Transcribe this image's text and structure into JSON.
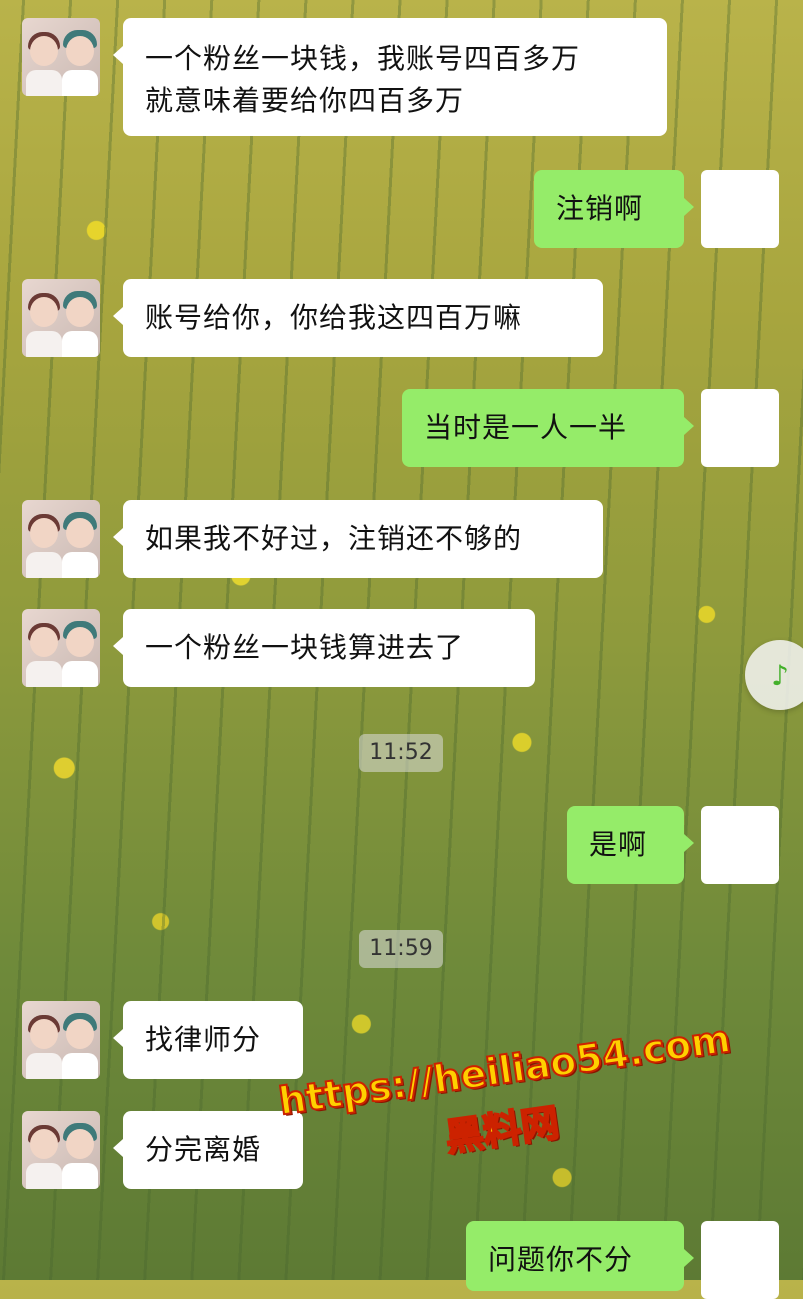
{
  "messages": [
    {
      "side": "left",
      "text_line1": "一个粉丝一块钱，我账号四百多万",
      "text_line2": "就意味着要给你四百多万"
    },
    {
      "side": "right",
      "text": "注销啊"
    },
    {
      "side": "left",
      "text": "账号给你，你给我这四百万嘛"
    },
    {
      "side": "right",
      "text": "当时是一人一半"
    },
    {
      "side": "left",
      "text": "如果我不好过，注销还不够的"
    },
    {
      "side": "left",
      "text": "一个粉丝一块钱算进去了"
    },
    {
      "side": "right",
      "text": "是啊"
    },
    {
      "side": "left",
      "text": "找律师分"
    },
    {
      "side": "left",
      "text": "分完离婚"
    },
    {
      "side": "right",
      "text": "问题你不分"
    }
  ],
  "timestamps": [
    "11:52",
    "11:59"
  ],
  "watermark": {
    "url": "https://heiliao54.com",
    "name": "黑料网"
  },
  "icons": {
    "music": "music-note-icon"
  },
  "colors": {
    "left_bubble": "#ffffff",
    "right_bubble": "#95ec69",
    "watermark_fill": "#ffd000",
    "watermark_stroke": "#cc2200"
  }
}
